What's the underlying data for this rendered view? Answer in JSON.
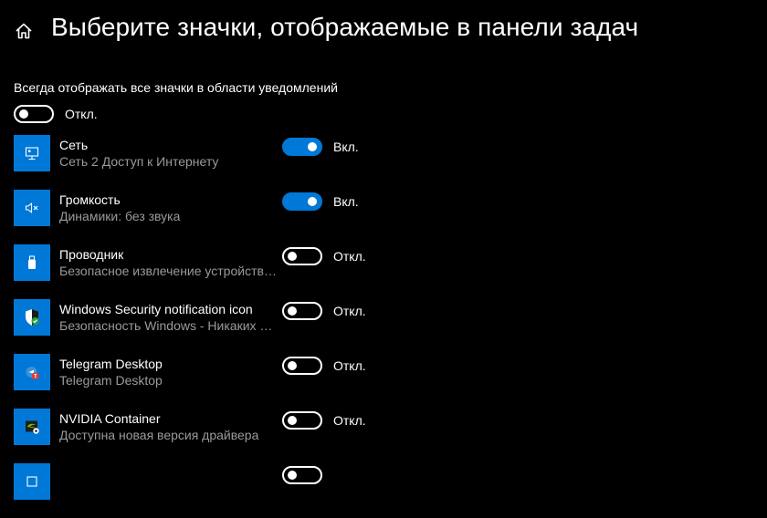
{
  "page": {
    "title": "Выберите значки, отображаемые в панели задач",
    "home_icon": "home-icon"
  },
  "master": {
    "label": "Всегда отображать все значки в области уведомлений",
    "on": false,
    "state_text": "Откл."
  },
  "items": [
    {
      "name": "Сеть",
      "desc": "Сеть 2 Доступ к Интернету",
      "on": true,
      "state_text": "Вкл.",
      "icon": "network-monitor-icon"
    },
    {
      "name": "Громкость",
      "desc": "Динамики: без звука",
      "on": true,
      "state_text": "Вкл.",
      "icon": "speaker-muted-icon"
    },
    {
      "name": "Проводник",
      "desc": "Безопасное извлечение устройств и дисков",
      "on": false,
      "state_text": "Откл.",
      "icon": "usb-drive-icon"
    },
    {
      "name": "Windows Security notification icon",
      "desc": "Безопасность Windows - Никаких действий не требуется",
      "on": false,
      "state_text": "Откл.",
      "icon": "security-shield-icon"
    },
    {
      "name": "Telegram Desktop",
      "desc": "Telegram Desktop",
      "on": false,
      "state_text": "Откл.",
      "icon": "telegram-icon"
    },
    {
      "name": "NVIDIA Container",
      "desc": "Доступна новая версия драйвера",
      "on": false,
      "state_text": "Откл.",
      "icon": "nvidia-icon"
    },
    {
      "name": "",
      "desc": "",
      "on": false,
      "state_text": "",
      "icon": "app-icon"
    }
  ],
  "colors": {
    "accent": "#0078d7",
    "background": "#000000",
    "text": "#ffffff",
    "secondary_text": "#9a9a9a"
  }
}
